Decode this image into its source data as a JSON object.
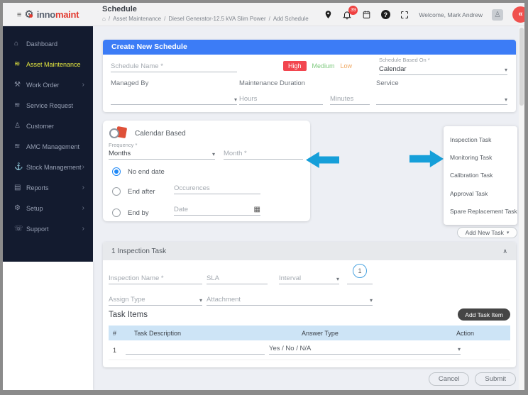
{
  "icons": {
    "menu": "≡",
    "gear": "⚙",
    "home": "⌂",
    "layers": "≋",
    "tools": "⚒",
    "person": "♙",
    "anchor": "⚓",
    "report": "▤",
    "phone": "☏",
    "chevron_right": "›",
    "caret": "▾",
    "chevron_up": "∧",
    "help": "?",
    "calendar_picker": "▦",
    "collapse": "«",
    "breadcrumb_home": "⌂",
    "breadcrumb_sep": "/"
  },
  "brand": {
    "part1": "inno",
    "part2": "maint"
  },
  "topbar": {
    "title": "Schedule",
    "breadcrumb": [
      "Asset Maintenance",
      "Diesel Generator-12.5 kVA Slim Power",
      "Add Schedule"
    ],
    "badge": "39",
    "welcome": "Welcome, Mark Andrew"
  },
  "sidebar": {
    "items": [
      {
        "label": "Dashboard"
      },
      {
        "label": "Asset Maintenance"
      },
      {
        "label": "Work Order"
      },
      {
        "label": "Service Request"
      },
      {
        "label": "Customer"
      },
      {
        "label": "AMC Management"
      },
      {
        "label": "Stock Management"
      },
      {
        "label": "Reports"
      },
      {
        "label": "Setup"
      },
      {
        "label": "Support"
      }
    ]
  },
  "schedule_form": {
    "title": "Create New Schedule",
    "schedule_name_ph": "Schedule Name *",
    "priority": {
      "high": "High",
      "medium": "Medium",
      "low": "Low"
    },
    "based_on_label": "Schedule Based On *",
    "based_on_value": "Calendar",
    "managed_by_label": "Managed By",
    "duration_label": "Maintenance Duration",
    "hours_ph": "Hours",
    "minutes_ph": "Minutes",
    "service_label": "Service"
  },
  "calendar_panel": {
    "title": "Calendar Based",
    "frequency_label": "Frequency *",
    "frequency_value": "Months",
    "month_ph": "Month *",
    "no_end_date": "No end date",
    "end_after": "End after",
    "occurrences_ph": "Occurences",
    "end_by": "End by",
    "date_ph": "Date"
  },
  "task_menu": {
    "items": [
      "Inspection Task",
      "Monitoring Task",
      "Calibration Task",
      "Approval Task",
      "Spare Replacement Task"
    ],
    "add_new_task": "Add New Task"
  },
  "inspection": {
    "header": "1 Inspection Task",
    "name_ph": "Inspection Name *",
    "sla_ph": "SLA",
    "interval_ph": "Interval",
    "interval_value": "1",
    "assign_type_ph": "Assign Type",
    "attachment_ph": "Attachment",
    "task_items_title": "Task Items",
    "add_task_item": "Add Task Item",
    "columns": [
      "#",
      "Task Description",
      "Answer Type",
      "Action"
    ],
    "row": {
      "num": "1",
      "answer": "Yes / No / N/A"
    }
  },
  "footer": {
    "cancel": "Cancel",
    "submit": "Submit"
  }
}
